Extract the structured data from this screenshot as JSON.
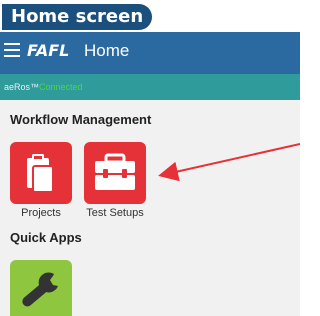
{
  "caption": "Home screen",
  "appbar": {
    "logo_text": "FAFL",
    "title": "Home",
    "menu_icon": "hamburger-menu-icon"
  },
  "status": {
    "device": "aeRos™",
    "state": "Connected"
  },
  "sections": {
    "workflow_heading": "Workflow Management",
    "quick_heading": "Quick Apps"
  },
  "tiles": {
    "projects_label": "Projects",
    "projects_icon": "clipboard-icon",
    "setups_label": "Test Setups",
    "setups_icon": "toolbox-icon",
    "quick_icon": "wrench-icon"
  },
  "colors": {
    "appbar": "#2a6aa0",
    "statusbar": "#2f9b9a",
    "tile_red": "#e53238",
    "tile_green": "#8ec63f",
    "arrow": "#e53238",
    "caption_bg": "#1b4f7e"
  }
}
